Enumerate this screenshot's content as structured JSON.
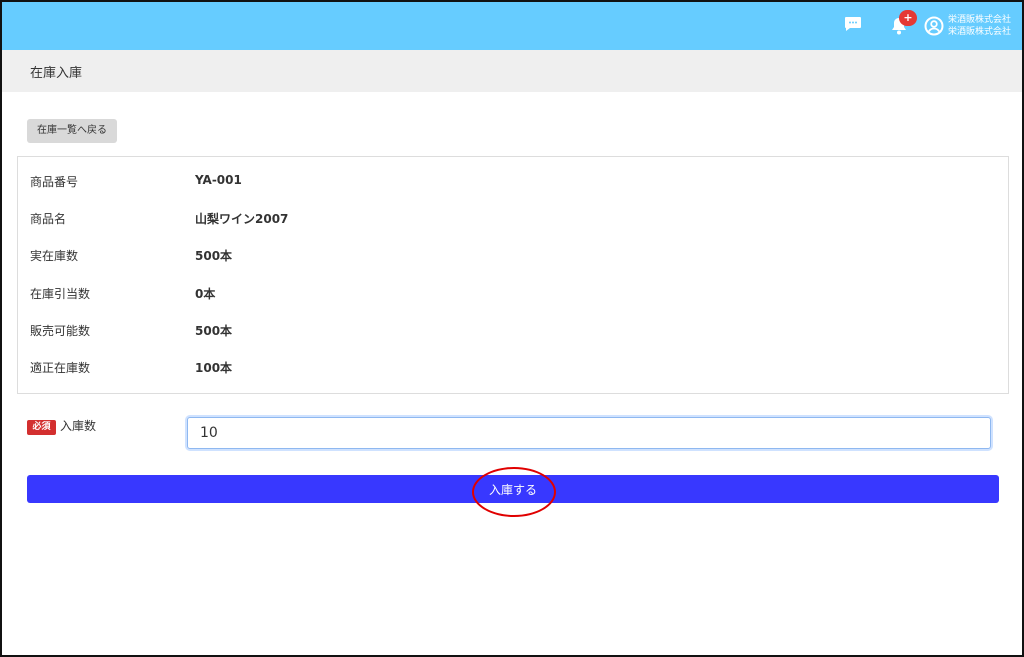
{
  "header": {
    "company_line1": "栄酒販株式会社",
    "company_line2": "栄酒販株式会社",
    "notification_badge": "+",
    "icons": [
      "chat-icon",
      "bell-icon",
      "user-circle-icon"
    ],
    "bg_color": "#66ccff"
  },
  "page": {
    "title": "在庫入庫"
  },
  "back_button": {
    "label": "在庫一覧へ戻る"
  },
  "info": {
    "rows": [
      {
        "label": "商品番号",
        "value": "YA-001"
      },
      {
        "label": "商品名",
        "value": "山梨ワイン2007"
      },
      {
        "label": "実在庫数",
        "value": "500本"
      },
      {
        "label": "在庫引当数",
        "value": "0本"
      },
      {
        "label": "販売可能数",
        "value": "500本"
      },
      {
        "label": "適正在庫数",
        "value": "100本"
      }
    ]
  },
  "form": {
    "required_badge": "必須",
    "quantity_label": "入庫数",
    "quantity_value": "10"
  },
  "submit": {
    "label": "入庫する",
    "color": "#3838ff"
  },
  "annotation": {
    "color": "#e00000"
  }
}
